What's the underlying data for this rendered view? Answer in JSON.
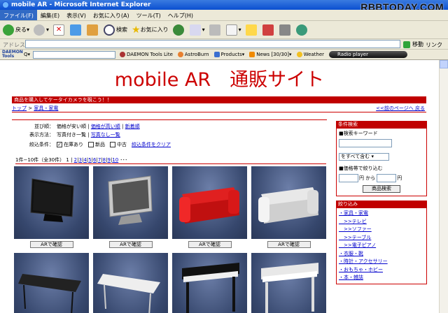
{
  "window": {
    "title": "mobile AR - Microsoft Internet Explorer",
    "watermark": "RBBTODAY.COM"
  },
  "menu": [
    "ファイル(F)",
    "編集(E)",
    "表示(V)",
    "お気に入り(A)",
    "ツール(T)",
    "ヘルプ(H)"
  ],
  "toolbar": {
    "back": "戻る",
    "search": "検索",
    "favorites": "お気に入り"
  },
  "address": {
    "label": "アドレス(D)",
    "go": "移動",
    "links": "リンク"
  },
  "daemon": {
    "logo_top": "DAEMON",
    "logo_bottom": "Tools",
    "items": [
      "DAEMON Tools Lite",
      "AstroBurn",
      "Products",
      "News [30/30]",
      "Weather"
    ],
    "radio": "Radio player"
  },
  "site": {
    "title": "mobile AR　通販サイト",
    "banner": "商品を購入してケータイカメラを覗こう！！",
    "breadcrumb": {
      "top": "トップ",
      "sep": " > ",
      "current": "家具・家電",
      "back": "<<前のページへ 戻る"
    },
    "sort": {
      "label": "並び順：",
      "opt1": "価格が安い順",
      "opt2": "価格が高い順",
      "opt3": "新着順"
    },
    "display": {
      "label": "表示方法：",
      "opt1": "写真付き一覧",
      "opt2": "写真なし一覧"
    },
    "narrow": {
      "label": "絞込条件：",
      "c1": "在庫あり",
      "c2": "新品",
      "c3": "中古",
      "clear": "絞込条件をクリア"
    },
    "pager": {
      "count": "1件−10件（全30件）",
      "current": "1",
      "pages": [
        "2",
        "3",
        "4",
        "5",
        "6",
        "7",
        "8",
        "9",
        "10"
      ],
      "more": "･･･"
    },
    "products": [
      {
        "button": "ARで確認",
        "kind": "tv-black"
      },
      {
        "button": "ARで確認",
        "kind": "tv-silver"
      },
      {
        "button": "ARで確認",
        "kind": "sofa-red"
      },
      {
        "button": "ARで確認",
        "kind": "sofa-white"
      },
      {
        "button": "",
        "kind": "table-dark"
      },
      {
        "button": "",
        "kind": "table-white"
      },
      {
        "button": "",
        "kind": "piano-black"
      },
      {
        "button": "",
        "kind": "piano-white"
      }
    ],
    "sidebar": {
      "search_head": "条件検索",
      "keyword_label": "■検索キーワード",
      "select_value": "をすべて含む",
      "price_label": "■価格帯で絞り込む",
      "yen_from": "円 から",
      "yen_to": "円",
      "search_button": "商品検索",
      "filter_head": "絞り込み",
      "categories": [
        "・家具・家電",
        "　>>テレビ",
        "　>>ソファー",
        "　>>テーブル",
        "　>>電子ピアノ",
        "・衣服・靴",
        "・時計・アクセサリー",
        "・おもちゃ・ホビー",
        "・本・雑誌"
      ]
    }
  },
  "colors": {
    "accent": "#c00000",
    "link": "#0000cc"
  }
}
